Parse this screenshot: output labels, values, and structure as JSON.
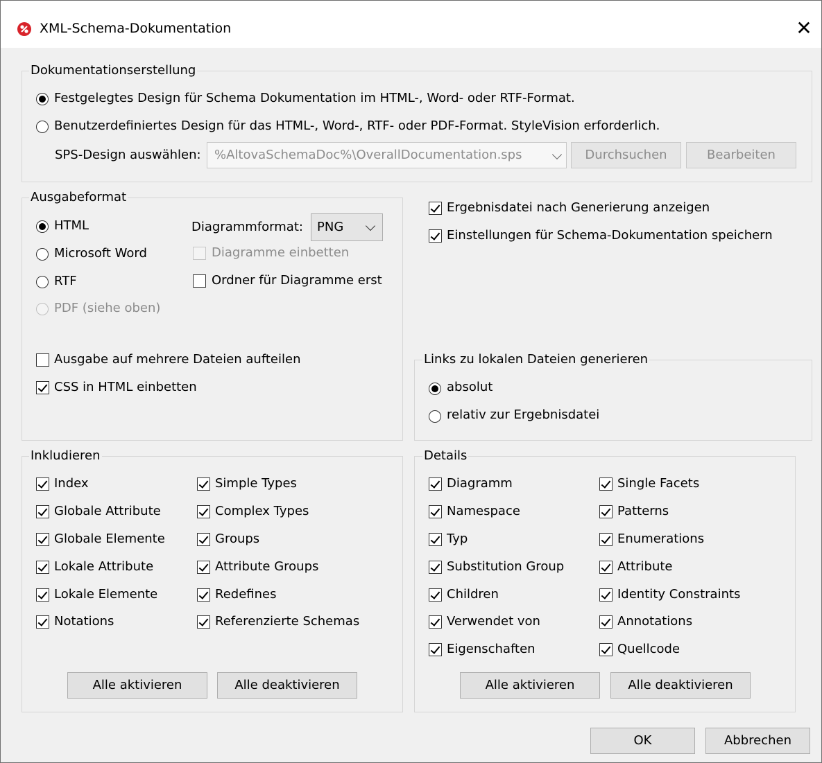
{
  "window": {
    "title": "XML-Schema-Dokumentation",
    "app_icon": "altova-logo-icon",
    "close_glyph": "✕"
  },
  "doc_creation": {
    "legend": "Dokumentationserstellung",
    "option_fixed": "Festgelegtes Design für Schema Dokumentation im HTML-, Word- oder RTF-Format.",
    "option_custom": "Benutzerdefiniertes Design für das HTML-, Word-, RTF- oder PDF-Format. StyleVision erforderlich.",
    "sps_label": "SPS-Design auswählen:",
    "sps_value": "%AltovaSchemaDoc%\\OverallDocumentation.sps",
    "browse_button": "Durchsuchen",
    "edit_button": "Bearbeiten"
  },
  "output_format": {
    "legend": "Ausgabeformat",
    "html": "HTML",
    "word": "Microsoft Word",
    "rtf": "RTF",
    "pdf": "PDF (siehe oben)",
    "diagram_format_label": "Diagrammformat:",
    "diagram_format_value": "PNG",
    "embed_diagrams": "Diagramme einbetten",
    "create_folder": "Ordner für Diagramme erst",
    "split_output": "Ausgabe auf mehrere Dateien aufteilen",
    "embed_css": "CSS in HTML einbetten"
  },
  "options": {
    "show_result": "Ergebnisdatei nach Generierung anzeigen",
    "save_settings": "Einstellungen für Schema-Dokumentation speichern"
  },
  "links": {
    "legend": "Links zu lokalen Dateien generieren",
    "absolute": "absolut",
    "relative": "relativ zur Ergebnisdatei"
  },
  "include": {
    "legend": "Inkludieren",
    "items": [
      "Index",
      "Globale Attribute",
      "Globale Elemente",
      "Lokale Attribute",
      "Lokale Elemente",
      "Notations",
      "Simple Types",
      "Complex Types",
      "Groups",
      "Attribute Groups",
      "Redefines",
      "Referenzierte Schemas"
    ],
    "enable_all": "Alle aktivieren",
    "disable_all": "Alle deaktivieren"
  },
  "details": {
    "legend": "Details",
    "items": [
      "Diagramm",
      "Namespace",
      "Typ",
      "Substitution Group",
      "Children",
      "Verwendet von",
      "Eigenschaften",
      "Single Facets",
      "Patterns",
      "Enumerations",
      "Attribute",
      "Identity Constraints",
      "Annotations",
      "Quellcode"
    ],
    "enable_all": "Alle aktivieren",
    "disable_all": "Alle deaktivieren"
  },
  "footer": {
    "ok": "OK",
    "cancel": "Abbrechen"
  }
}
